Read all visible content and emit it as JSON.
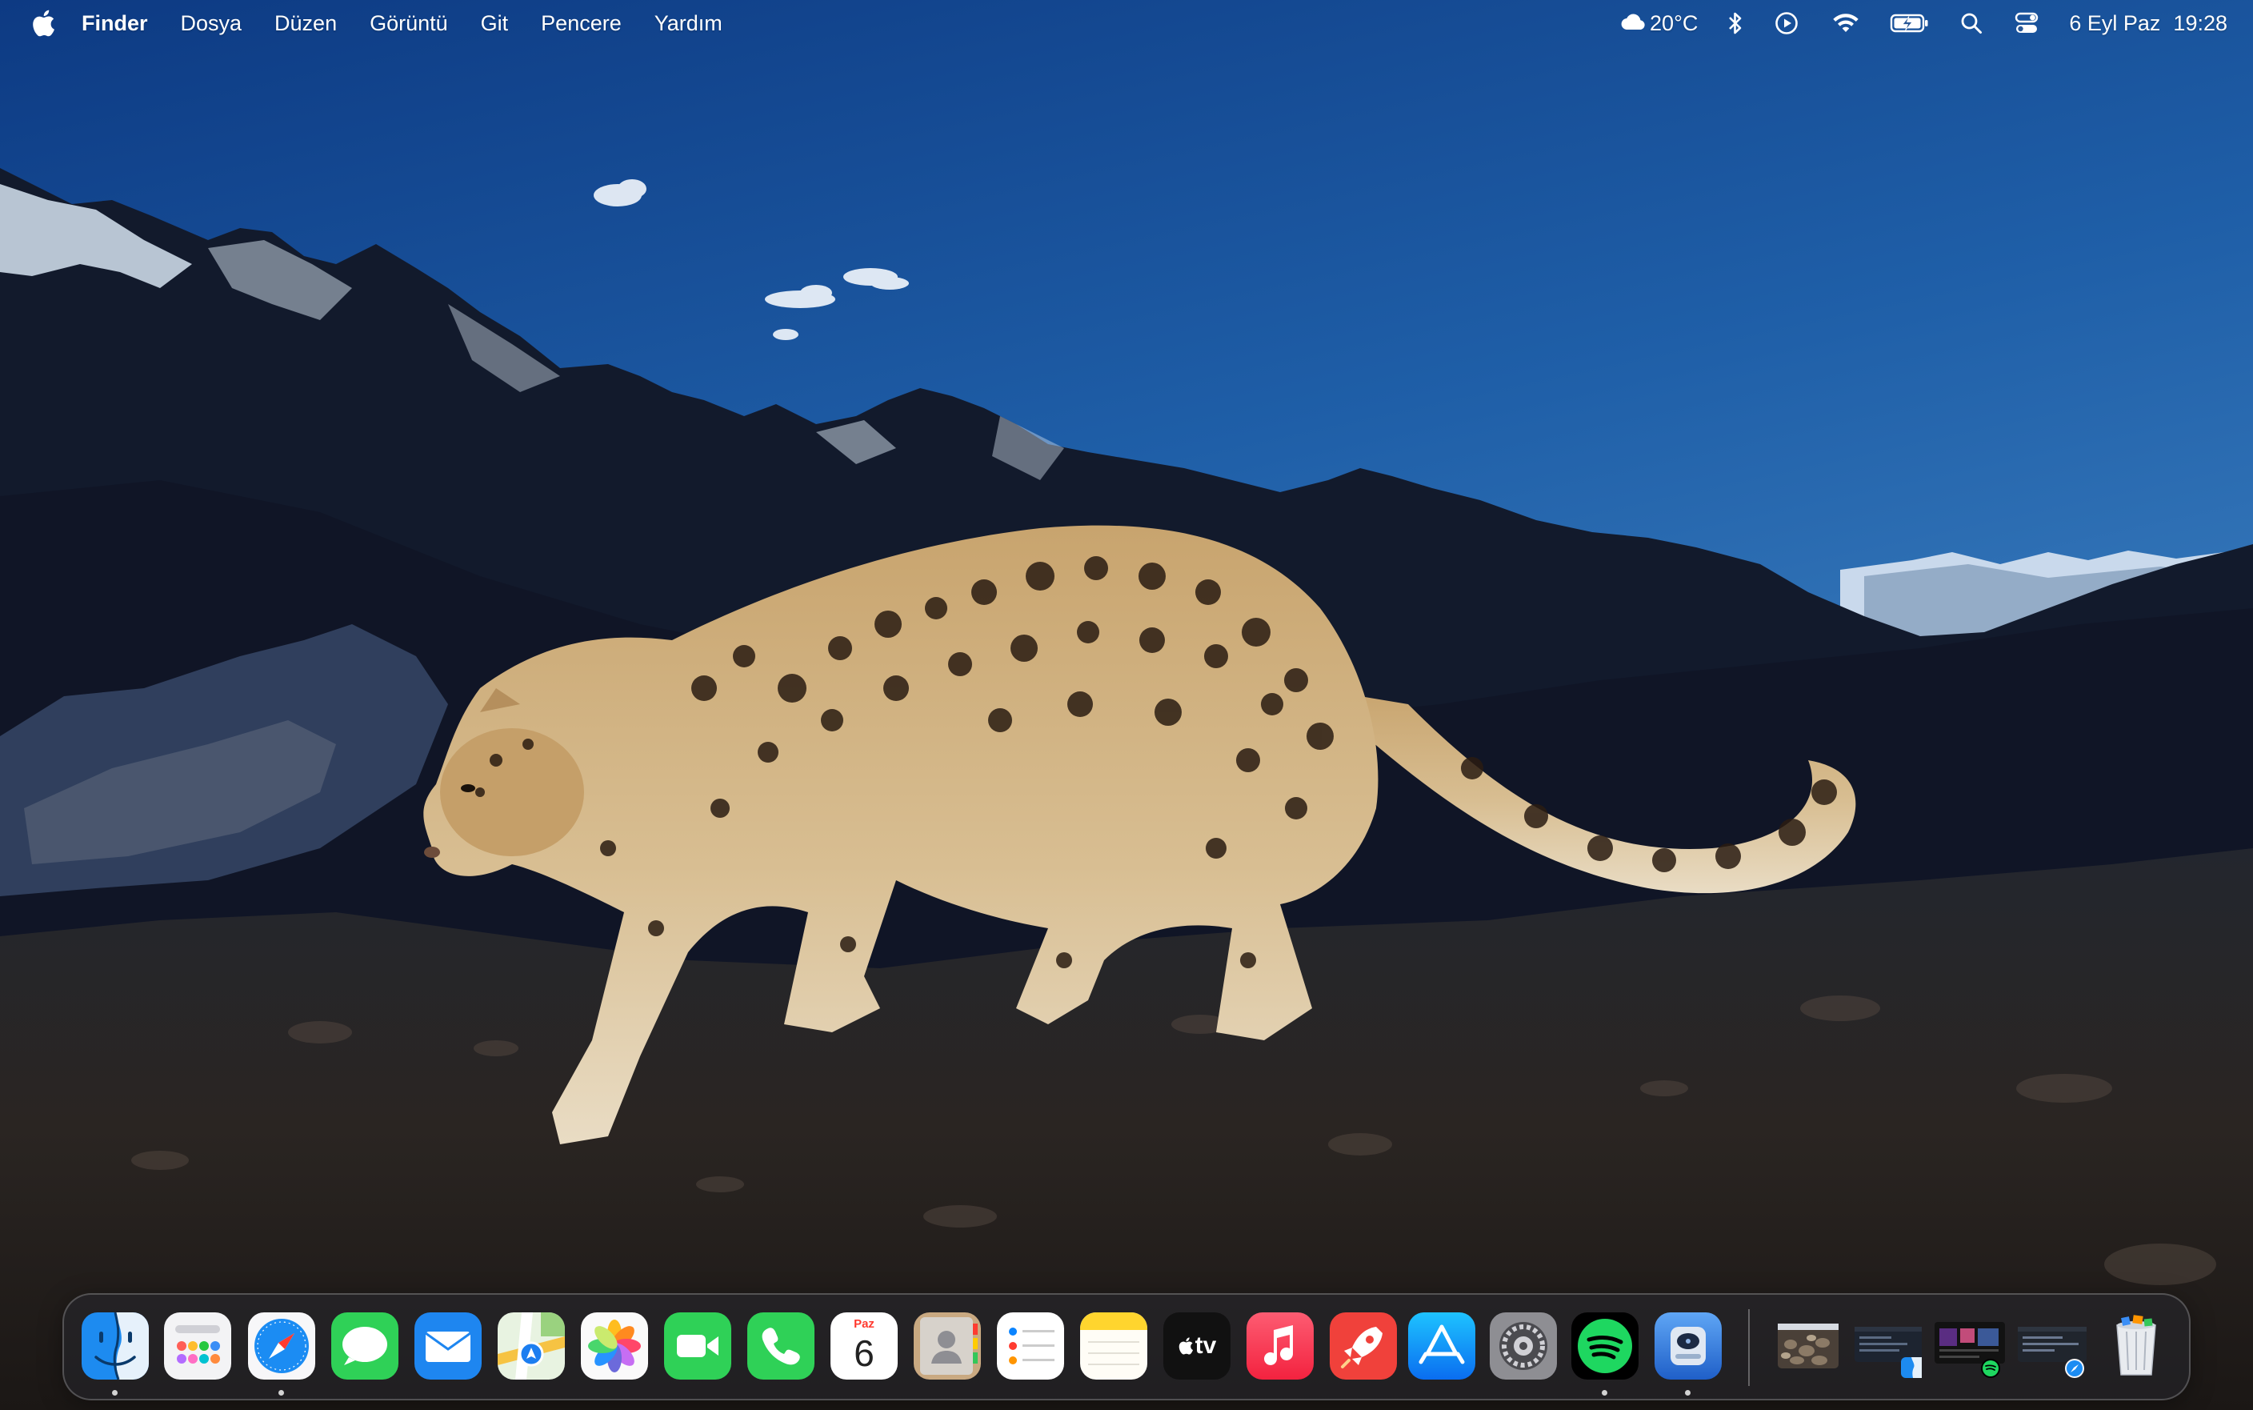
{
  "menubar": {
    "app_name": "Finder",
    "menus": [
      "Dosya",
      "Düzen",
      "Görüntü",
      "Git",
      "Pencere",
      "Yardım"
    ],
    "weather": "20°C",
    "date": "6 Eyl Paz",
    "time": "19:28"
  },
  "dock": {
    "calendar_month": "Paz",
    "calendar_day": "6",
    "tv_label": "tv",
    "apps": [
      "finder",
      "launchpad",
      "safari",
      "messages",
      "mail",
      "maps",
      "photos",
      "facetime",
      "phone",
      "calendar",
      "contacts",
      "reminders",
      "notes",
      "apple-tv",
      "music",
      "rocket",
      "app-store",
      "system-settings",
      "spotify",
      "disk-utility"
    ],
    "running": [
      "finder",
      "safari",
      "spotify",
      "disk-utility"
    ],
    "minimized_windows": [
      "photo-window",
      "finder-window",
      "spotify-window",
      "safari-window"
    ],
    "trash": "trash"
  },
  "colors": {
    "sky_top": "#0f3f8a",
    "sky_bottom": "#3f86c6",
    "accent_spotify": "#1ed760"
  }
}
